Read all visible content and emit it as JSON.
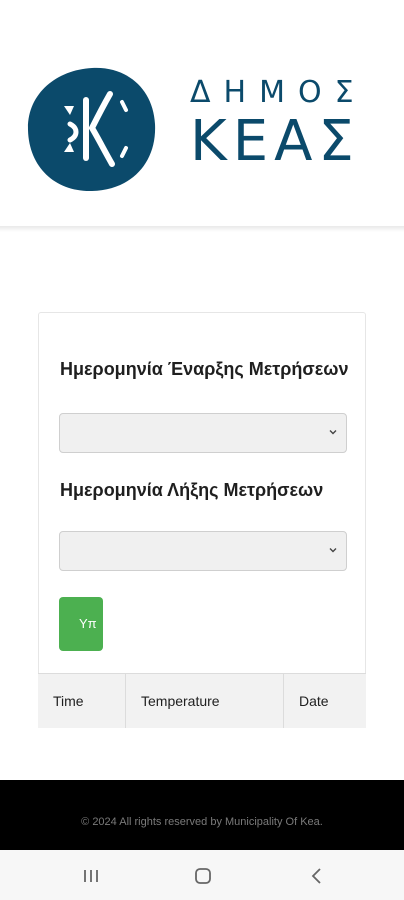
{
  "brand": {
    "line1": "ΔΗΜΟΣ",
    "line2": "ΚΕΑΣ",
    "color": "#0b4a6b"
  },
  "form": {
    "start_label": "Ημερομηνία Έναρξης Μετρήσεων",
    "start_value": "",
    "end_label": "Ημερομηνία Λήξης Μετρήσεων",
    "end_value": "",
    "submit_label": "Υπ",
    "submit_color": "#4cb050"
  },
  "table": {
    "columns": [
      "Time",
      "Temperature",
      "Date"
    ]
  },
  "footer": {
    "text": "© 2024 All rights reserved by Municipality Of Kea."
  },
  "system_nav": {
    "icons": [
      "recent-apps-icon",
      "home-icon",
      "back-icon"
    ]
  }
}
